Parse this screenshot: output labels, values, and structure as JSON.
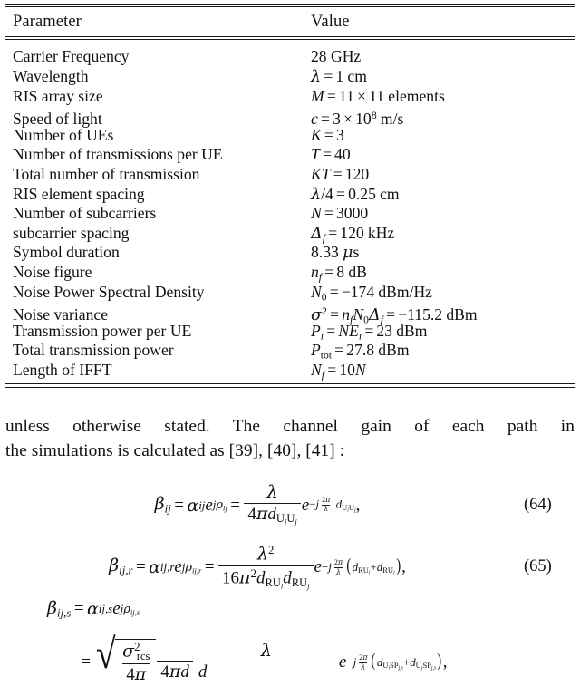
{
  "document": {
    "type": "academic-paper-page",
    "table": {
      "columns": [
        "Parameter",
        "Value"
      ],
      "rows": [
        {
          "parameter": "Carrier Frequency",
          "value": "28 GHz"
        },
        {
          "parameter": "Wavelength",
          "value": "λ = 1 cm"
        },
        {
          "parameter": "RIS array size",
          "value": "M = 11 × 11 elements"
        },
        {
          "parameter": "Speed of light",
          "value": "c = 3 × 10^8 m/s"
        },
        {
          "parameter": "Number of UEs",
          "value": "K = 3"
        },
        {
          "parameter": "Number of transmissions per UE",
          "value": "T = 40"
        },
        {
          "parameter": "Total number of transmission",
          "value": "KT = 120"
        },
        {
          "parameter": "RIS element spacing",
          "value": "λ/4 = 0.25 cm"
        },
        {
          "parameter": "Number of subcarriers",
          "value": "N = 3000"
        },
        {
          "parameter": "subcarrier spacing",
          "value": "Δ_f = 120 kHz"
        },
        {
          "parameter": "Symbol duration",
          "value": "8.33 µs"
        },
        {
          "parameter": "Noise figure",
          "value": "n_f = 8 dB"
        },
        {
          "parameter": "Noise Power Spectral Density",
          "value": "N_0 = −174 dBm/Hz"
        },
        {
          "parameter": "Noise variance",
          "value": "σ² = n_f N_0 Δ_f = −115.2 dBm"
        },
        {
          "parameter": "Transmission power per UE",
          "value": "P_i = N E_i = 23 dBm"
        },
        {
          "parameter": "Total transmission power",
          "value": "P_tot = 27.8 dBm"
        },
        {
          "parameter": "Length of IFFT",
          "value": "N_f = 10N"
        }
      ]
    },
    "paragraph": {
      "line1": "unless otherwise stated. The channel gain of each path in",
      "line2": "the simulations is calculated as [39], [40], [41] :"
    },
    "equations": [
      {
        "number": "(64)",
        "latex": "\\beta_{ij} = \\alpha_{ij} e^{j\\rho_{ij}} = \\frac{\\lambda}{4\\pi d_{U_i U_j}} e^{-j\\frac{2\\pi}{\\lambda} d_{U_i U_j}},"
      },
      {
        "number": "(65)",
        "latex": "\\beta_{ij,r} = \\alpha_{ij,r} e^{j\\rho_{ij,r}} = \\frac{\\lambda^2}{16\\pi^2 d_{RU_i} d_{RU_j}} e^{-j\\frac{2\\pi}{\\lambda}(d_{RU_i}+d_{RU_j})},"
      },
      {
        "number": "",
        "latex": "\\beta_{ij,s} = \\alpha_{ij,s} e^{j\\rho_{ij,s}} = \\sqrt{\\frac{\\sigma^2_{rcs}}{4\\pi}}\\frac{\\lambda}{4\\pi d \\cdots d} e^{-j\\frac{2\\pi}{\\lambda}(d_{U_i SP_{j,s}} + d_{U_j SP_{j,s}})},"
      }
    ],
    "equation_numbers": {
      "eq64": "(64)",
      "eq65": "(65)"
    }
  }
}
